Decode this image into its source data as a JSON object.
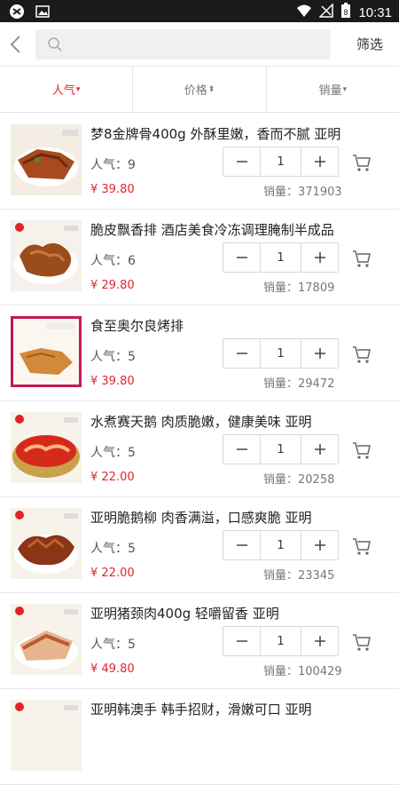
{
  "status_bar": {
    "time": "10:31",
    "battery_level": "8"
  },
  "search": {
    "placeholder": "",
    "filter_label": "筛选"
  },
  "sort_tabs": [
    {
      "label": "人气",
      "arrow": "▾"
    },
    {
      "label": "价格",
      "arrow": "⬍"
    },
    {
      "label": "销量",
      "arrow": "▾"
    }
  ],
  "colors": {
    "accent": "#e0242b",
    "status_bar": "#1a1a1a"
  },
  "products": [
    {
      "name": "梦8金牌骨400g 外酥里嫩，香而不腻 亚明",
      "popularity": "人气：9",
      "price": "¥ 39.80",
      "qty": "1",
      "sales": "销量：371903",
      "thumb_style": "ribs"
    },
    {
      "name": "脆皮飘香排 酒店美食冷冻调理腌制半成品",
      "popularity": "人气：6",
      "price": "¥ 29.80",
      "qty": "1",
      "sales": "销量：17809",
      "thumb_style": "fried"
    },
    {
      "name": "食至奥尔良烤排",
      "popularity": "人气：5",
      "price": "¥ 39.80",
      "qty": "1",
      "sales": "销量：29472",
      "thumb_style": "framed"
    },
    {
      "name": "水煮赛天鹅 肉质脆嫩，健康美味 亚明",
      "popularity": "人气：5",
      "price": "¥ 22.00",
      "qty": "1",
      "sales": "销量：20258",
      "thumb_style": "stew"
    },
    {
      "name": "亚明脆鹅柳 肉香满溢，口感爽脆  亚明",
      "popularity": "人气：5",
      "price": "¥ 22.00",
      "qty": "1",
      "sales": "销量：23345",
      "thumb_style": "goose"
    },
    {
      "name": "亚明猪颈肉400g 轻嚼留香 亚明",
      "popularity": "人气：5",
      "price": "¥ 49.80",
      "qty": "1",
      "sales": "销量：100429",
      "thumb_style": "pork"
    },
    {
      "name": "亚明韩澳手 韩手招财，滑嫩可口 亚明",
      "popularity": "",
      "price": "",
      "qty": "",
      "sales": "",
      "thumb_style": "ribs"
    }
  ]
}
